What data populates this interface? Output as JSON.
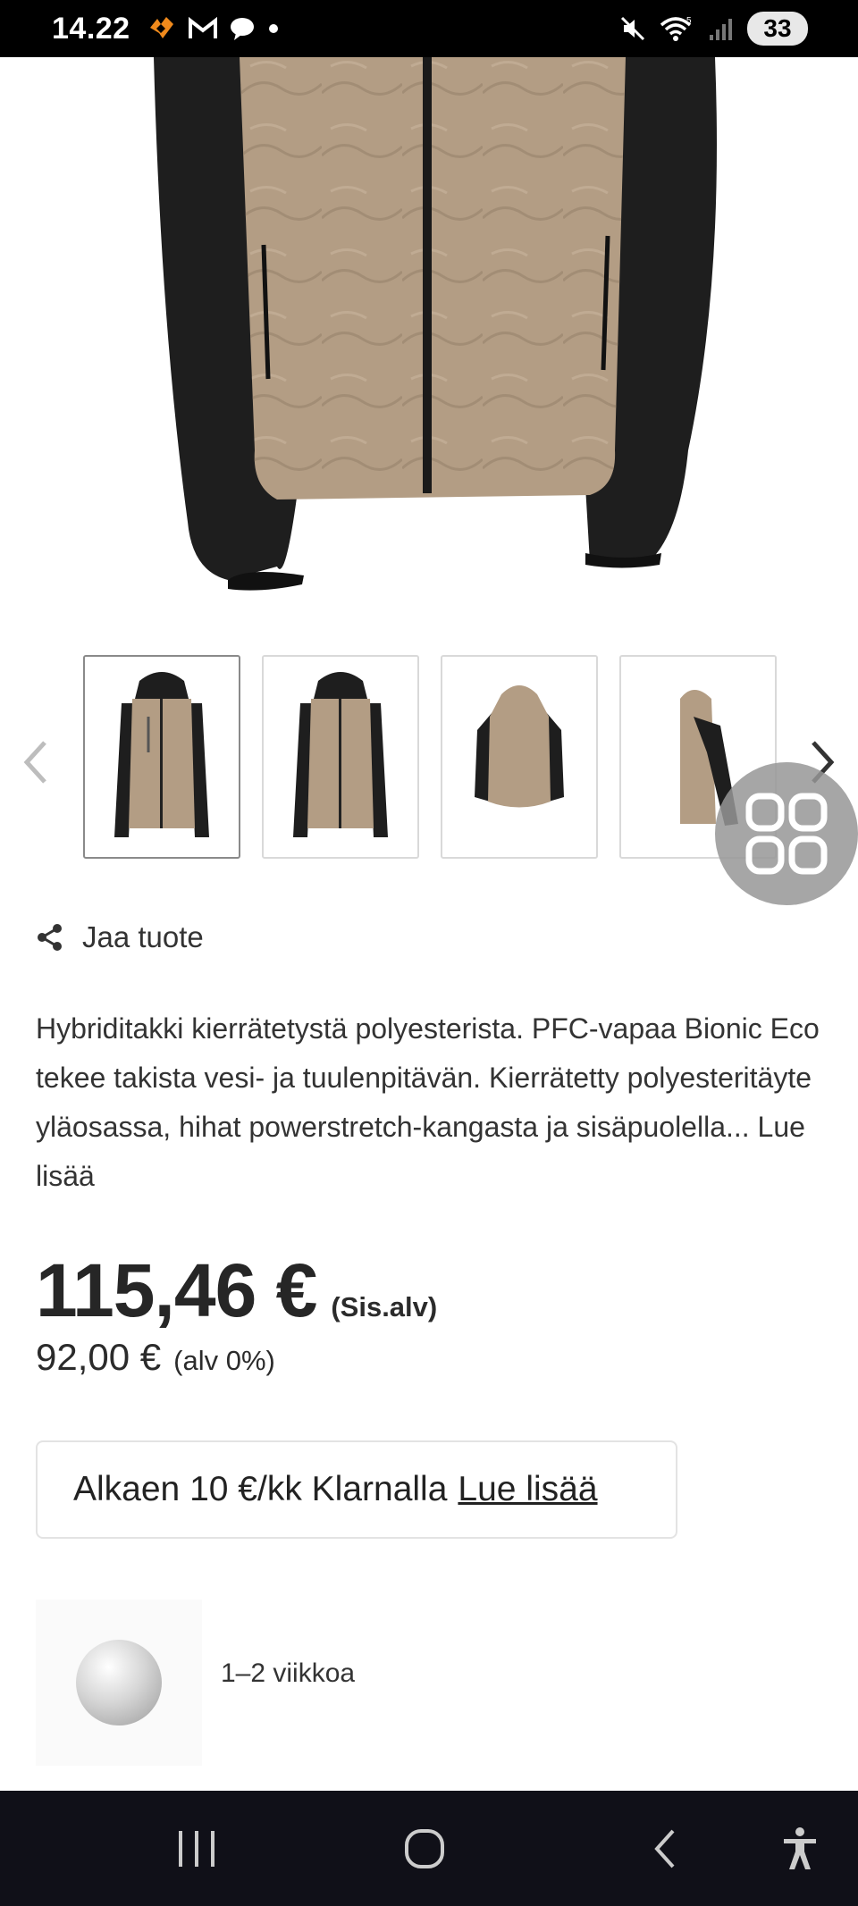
{
  "status_bar": {
    "time": "14.22",
    "battery": "33",
    "wifi_label": "5"
  },
  "product": {
    "share_label": "Jaa tuote",
    "description": "Hybriditakki kierrätetystä polyesterista. PFC-vapaa Bionic Eco tekee takista vesi- ja tuulenpitävän. Kierrätetty polyesteritäyte yläosassa, hihat powerstretch-kangasta ja sisäpuolella...",
    "read_more": "Lue lisää",
    "price": "115,46 €",
    "price_vat_label": "(Sis.alv)",
    "price_excl": "92,00 €",
    "price_excl_label": "(alv 0%)",
    "klarna_text": "Alkaen 10 €/kk Klarnalla",
    "klarna_link": "Lue lisää",
    "delivery": "1–2 viikkoa"
  },
  "thumbnails": [
    {
      "view": "front-hood-up",
      "selected": true
    },
    {
      "view": "front",
      "selected": false
    },
    {
      "view": "back",
      "selected": false
    },
    {
      "view": "side",
      "selected": false
    }
  ],
  "colors": {
    "jacket_beige": "#b39d84",
    "jacket_black": "#1e1e1e",
    "navbar_bg": "#101018",
    "text": "#2b2b2b"
  },
  "icons": {
    "share": "share-icon",
    "prev": "chevron-left-icon",
    "next": "chevron-right-icon",
    "fab": "grid-icon"
  }
}
